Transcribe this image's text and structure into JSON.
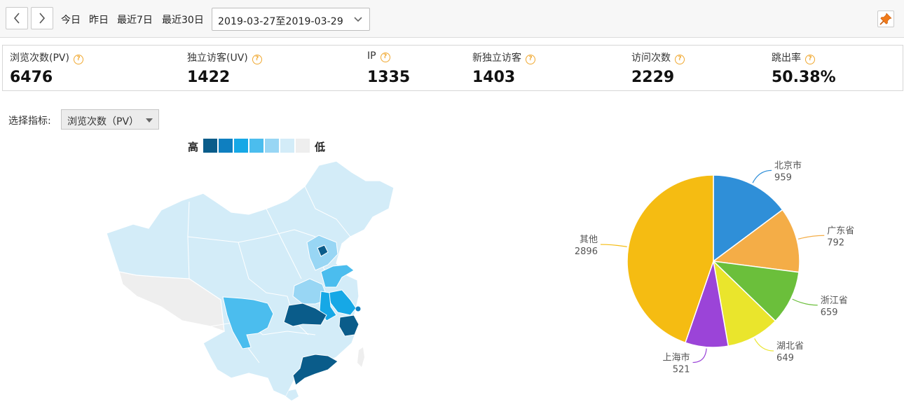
{
  "toolbar": {
    "quick_ranges": [
      "今日",
      "昨日",
      "最近7日",
      "最近30日"
    ],
    "date_range": "2019-03-27至2019-03-29"
  },
  "stats": [
    {
      "label": "浏览次数(PV)",
      "value": "6476"
    },
    {
      "label": "独立访客(UV)",
      "value": "1422"
    },
    {
      "label": "IP",
      "value": "1335"
    },
    {
      "label": "新独立访客",
      "value": "1403"
    },
    {
      "label": "访问次数",
      "value": "2229"
    },
    {
      "label": "跳出率",
      "value": "50.38%"
    }
  ],
  "selector": {
    "label": "选择指标:",
    "value": "浏览次数（PV）"
  },
  "legend": {
    "high": "高",
    "low": "低",
    "colors": [
      "#0a5c8a",
      "#0f7fc0",
      "#16a8e6",
      "#4bbdee",
      "#98d6f4",
      "#d3ecf8",
      "#eeeeee"
    ]
  },
  "chart_data": {
    "type": "pie",
    "labels": [
      "北京市",
      "广东省",
      "浙江省",
      "湖北省",
      "上海市",
      "其他"
    ],
    "values": [
      959,
      792,
      659,
      649,
      521,
      2896
    ],
    "colors": [
      "#2f8fd8",
      "#f4ad47",
      "#6bbf3b",
      "#eae52c",
      "#9b44d8",
      "#f5bc12"
    ]
  }
}
